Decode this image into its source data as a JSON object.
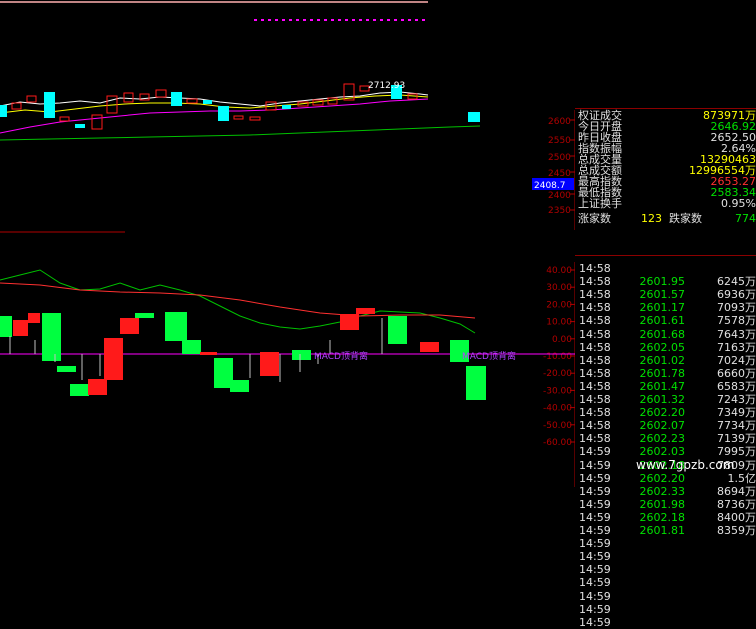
{
  "price_axis": [
    "2600",
    "2550",
    "2500",
    "2450",
    "2408.7",
    "2400",
    "2350"
  ],
  "indicator_axis": [
    "40.00",
    "30.00",
    "20.00",
    "10.00",
    "0.00",
    "-10.00",
    "-20.00",
    "-30.00",
    "-40.00",
    "-50.00",
    "-60.00"
  ],
  "candle_price_label": "2712.93",
  "signal_labels": {
    "left": "MACD顶背离",
    "right": "MACD顶背离"
  },
  "stats": [
    {
      "label": "权证成交",
      "value": "873971万",
      "color": "#ffff00"
    },
    {
      "label": "今日开盘",
      "value": "2646.92",
      "color": "#00e000"
    },
    {
      "label": "昨日收盘",
      "value": "2652.50",
      "color": "#e0e0e0"
    },
    {
      "label": "指数振幅",
      "value": "2.64%",
      "color": "#e0e0e0"
    },
    {
      "label": "总成交量",
      "value": "13290463",
      "color": "#ffff00"
    },
    {
      "label": "总成交额",
      "value": "12996554万",
      "color": "#ffff00"
    },
    {
      "label": "最高指数",
      "value": "2653.27",
      "color": "#ff3030"
    },
    {
      "label": "最低指数",
      "value": "2583.34",
      "color": "#00e000"
    },
    {
      "label": "上证换手",
      "value": "0.95%",
      "color": "#e0e0e0"
    }
  ],
  "updown": {
    "up_label": "涨家数",
    "up_value": "123",
    "down_label": "跌家数",
    "down_value": "774"
  },
  "ticks": [
    {
      "time": "14:58",
      "price": "",
      "volume": ""
    },
    {
      "time": "14:58",
      "price": "2601.95",
      "volume": "6245万"
    },
    {
      "time": "14:58",
      "price": "2601.57",
      "volume": "6936万"
    },
    {
      "time": "14:58",
      "price": "2601.17",
      "volume": "7093万"
    },
    {
      "time": "14:58",
      "price": "2601.61",
      "volume": "7578万"
    },
    {
      "time": "14:58",
      "price": "2601.68",
      "volume": "7643万"
    },
    {
      "time": "14:58",
      "price": "2602.05",
      "volume": "7163万"
    },
    {
      "time": "14:58",
      "price": "2601.02",
      "volume": "7024万"
    },
    {
      "time": "14:58",
      "price": "2601.78",
      "volume": "6660万"
    },
    {
      "time": "14:58",
      "price": "2601.47",
      "volume": "6583万"
    },
    {
      "time": "14:58",
      "price": "2601.32",
      "volume": "7243万"
    },
    {
      "time": "14:58",
      "price": "2602.20",
      "volume": "7349万"
    },
    {
      "time": "14:58",
      "price": "2602.07",
      "volume": "7734万"
    },
    {
      "time": "14:58",
      "price": "2602.23",
      "volume": "7139万"
    },
    {
      "time": "14:59",
      "price": "2602.03",
      "volume": "7995万"
    },
    {
      "time": "14:59",
      "price": "2602.18",
      "volume": "7809万"
    },
    {
      "time": "14:59",
      "price": "2602.20",
      "volume": "1.5亿"
    },
    {
      "time": "14:59",
      "price": "2602.33",
      "volume": "8694万"
    },
    {
      "time": "14:59",
      "price": "2601.98",
      "volume": "8736万"
    },
    {
      "time": "14:59",
      "price": "2602.18",
      "volume": "8400万"
    },
    {
      "time": "14:59",
      "price": "2601.81",
      "volume": "8359万"
    },
    {
      "time": "14:59",
      "price": "",
      "volume": ""
    },
    {
      "time": "14:59",
      "price": "",
      "volume": ""
    },
    {
      "time": "14:59",
      "price": "",
      "volume": ""
    },
    {
      "time": "14:59",
      "price": "",
      "volume": ""
    },
    {
      "time": "14:59",
      "price": "",
      "volume": ""
    },
    {
      "time": "14:59",
      "price": "",
      "volume": ""
    },
    {
      "time": "14:59",
      "price": "",
      "volume": ""
    }
  ],
  "watermark": "www.7gpzb.com",
  "colors": {
    "up": "#ff1a1a",
    "down": "#00ff40",
    "flat": "#00ffff",
    "axis": "#b00000",
    "ma_white": "#ffffff",
    "ma_yellow": "#ffff00",
    "ma_magenta": "#ff00ff",
    "ma_green": "#00c000"
  }
}
